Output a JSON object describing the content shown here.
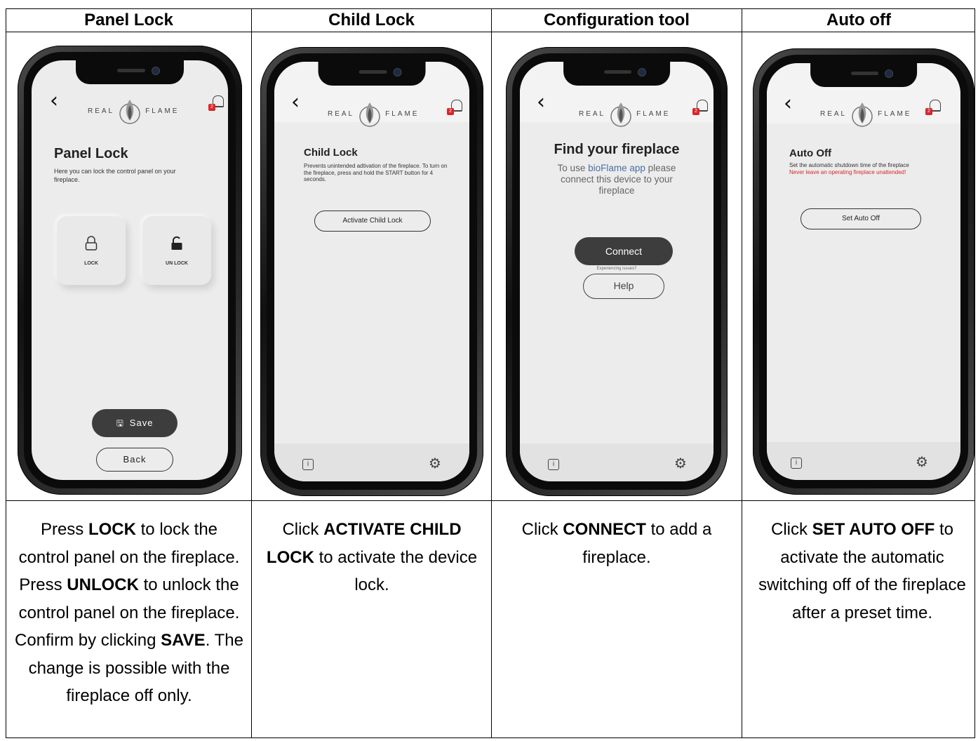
{
  "columns": [
    {
      "title": "Panel Lock",
      "phone": {
        "logo_left": "REAL",
        "logo_right": "FLAME",
        "heading": "Panel Lock",
        "text": "Here you can lock the control panel on your fireplace.",
        "tile_lock": "LOCK",
        "tile_unlock": "UN LOCK",
        "save": "Save",
        "back": "Back",
        "bell_count": "2"
      },
      "desc_parts": [
        "Press ",
        "LOCK",
        " to lock the control panel on the fireplace. Press ",
        "UNLOCK",
        " to unlock the control panel on the fireplace. Confirm by clicking ",
        "SAVE",
        ". The change is possible with the fireplace off only."
      ]
    },
    {
      "title": "Child Lock",
      "phone": {
        "logo_left": "REAL",
        "logo_right": "FLAME",
        "heading": "Child Lock",
        "text": "Prevents unintended adtivation of the fireplace. To turn on the fireplace, press and hold the START button for 4 seconds.",
        "button": "Activate Child Lock",
        "bell_count": "2"
      },
      "desc_parts": [
        "Click ",
        "ACTIVATE CHILD LOCK",
        " to activate the device lock."
      ]
    },
    {
      "title": "Configuration tool",
      "phone": {
        "logo_left": "REAL",
        "logo_right": "FLAME",
        "heading": "Find your fireplace",
        "text_a": "To use ",
        "text_b": "bioFlame app",
        "text_c": " please connect this device to your fireplace",
        "connect": "Connect",
        "issues": "Experiencing issues?",
        "help": "Help",
        "bell_count": "2"
      },
      "desc_parts": [
        "Click ",
        "CONNECT",
        " to add a fireplace."
      ]
    },
    {
      "title": "Auto off",
      "phone": {
        "logo_left": "REAL",
        "logo_right": "FLAME",
        "heading": "Auto Off",
        "text": "Set the automatic shutdown time of the fireplace",
        "warning": "Never leave an operating fireplace unattended!",
        "button": "Set Auto Off",
        "bell_count": "2"
      },
      "desc_parts": [
        "Click ",
        "SET AUTO OFF",
        " to activate the automatic switching off of the fireplace after a preset time."
      ]
    }
  ],
  "icons": {
    "back": "chevron-left-icon",
    "bell": "bell-icon",
    "info": "info-icon",
    "gear": "gear-icon",
    "lock": "lock-icon",
    "unlock": "unlock-icon",
    "save": "save-icon"
  },
  "colors": {
    "accent_red": "#d9252a",
    "button_dark": "#3d3d3d",
    "screen_bg": "#ececec",
    "link_blue": "#4a6fa5"
  }
}
